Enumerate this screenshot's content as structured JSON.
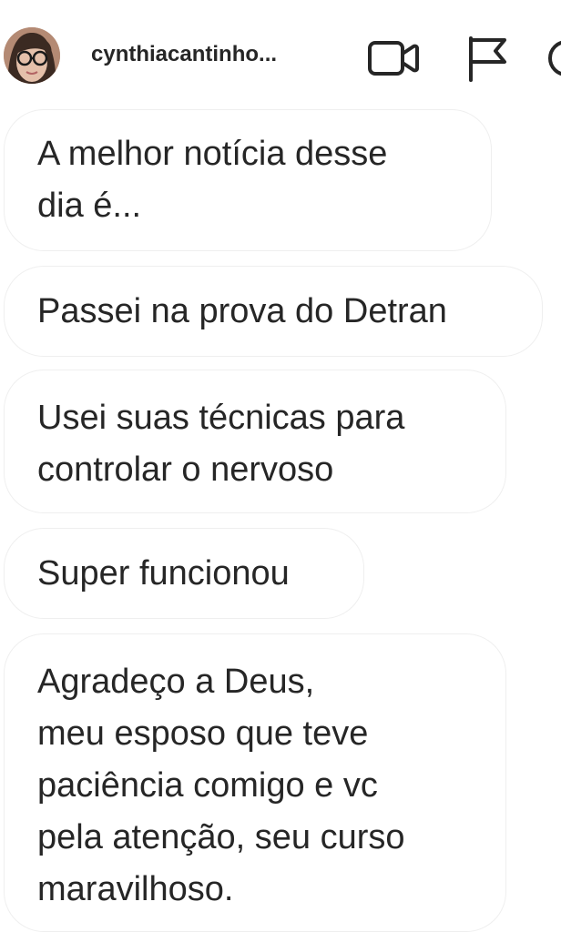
{
  "header": {
    "username": "cynthiacantinho...",
    "avatar_icon": "avatar-photo",
    "video_call_icon": "video-camera-icon",
    "report_icon": "flag-icon",
    "info_icon": "info-icon"
  },
  "messages": [
    {
      "text": "A melhor notícia desse\ndia é..."
    },
    {
      "text": "Passei na prova do Detran"
    },
    {
      "text": "Usei suas técnicas para\ncontrolar o nervoso"
    },
    {
      "text": "Super funcionou"
    },
    {
      "text": "Agradeço a Deus,\nmeu esposo que teve\npaciência comigo e vc\npela atenção, seu curso\nmaravilhoso."
    }
  ],
  "colors": {
    "text": "#262626",
    "bubble_border": "#efefef",
    "background": "#ffffff"
  }
}
